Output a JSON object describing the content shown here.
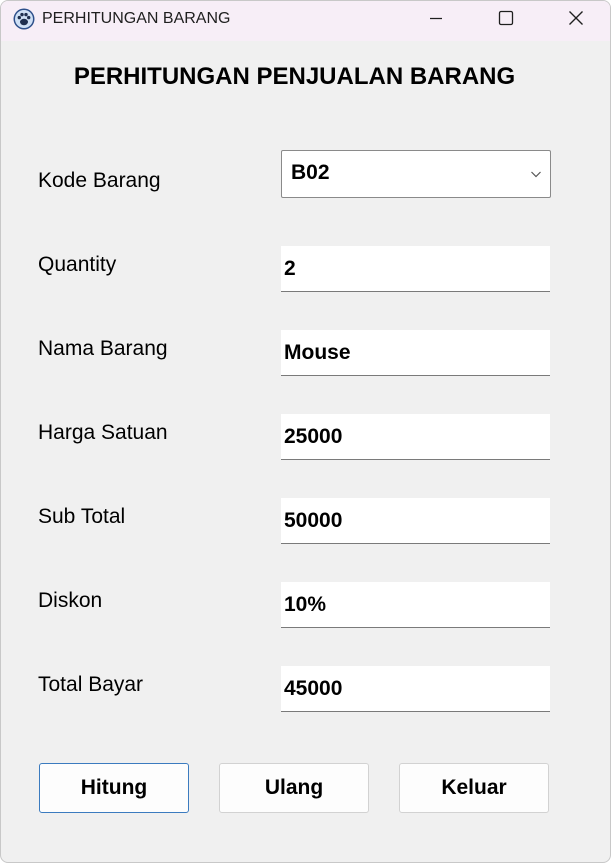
{
  "window": {
    "title": "PERHITUNGAN BARANG",
    "icon": "paw-icon",
    "controls": [
      "minimize-icon",
      "maximize-icon",
      "close-icon"
    ]
  },
  "heading": "PERHITUNGAN PENJUALAN BARANG",
  "form": {
    "kode_barang": {
      "label": "Kode Barang",
      "value": "B02"
    },
    "quantity": {
      "label": "Quantity",
      "value": "2"
    },
    "nama_barang": {
      "label": "Nama Barang",
      "value": "Mouse"
    },
    "harga_satuan": {
      "label": "Harga Satuan",
      "value": "25000"
    },
    "sub_total": {
      "label": "Sub Total",
      "value": "50000"
    },
    "diskon": {
      "label": "Diskon",
      "value": "10%"
    },
    "total_bayar": {
      "label": "Total Bayar",
      "value": "45000"
    }
  },
  "buttons": {
    "hitung": "Hitung",
    "ulang": "Ulang",
    "keluar": "Keluar"
  },
  "colors": {
    "background": "#f0f0f0",
    "titlebar": "#f7eef7",
    "primary_border": "#3b7bbf"
  }
}
